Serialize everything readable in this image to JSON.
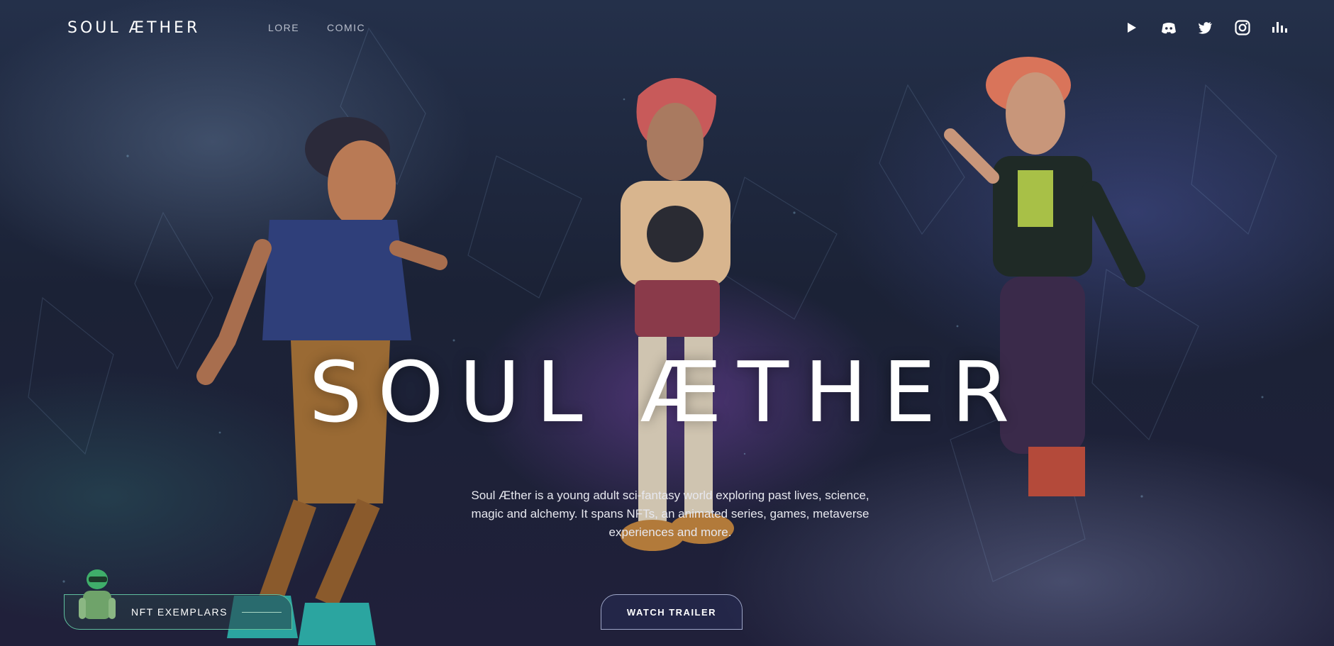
{
  "header": {
    "logo": "SOUL ÆTHER",
    "nav": [
      {
        "label": "LORE"
      },
      {
        "label": "COMIC"
      }
    ],
    "social_icons": [
      "play-icon",
      "discord-icon",
      "twitter-icon",
      "instagram-icon",
      "audio-bars-icon"
    ]
  },
  "hero": {
    "title": "SOUL ÆTHER",
    "description": "Soul Æther is a young adult sci-fantasy world exploring past lives, science, magic and alchemy. It spans NFTs, an animated series, games, metaverse experiences and more.",
    "trailer_button": "WATCH TRAILER"
  },
  "nft_button": {
    "label": "NFT EXEMPLARS"
  },
  "colors": {
    "background": "#1b2233",
    "nft_border": "#5fbf9e",
    "trailer_border": "#9ea6c8"
  }
}
